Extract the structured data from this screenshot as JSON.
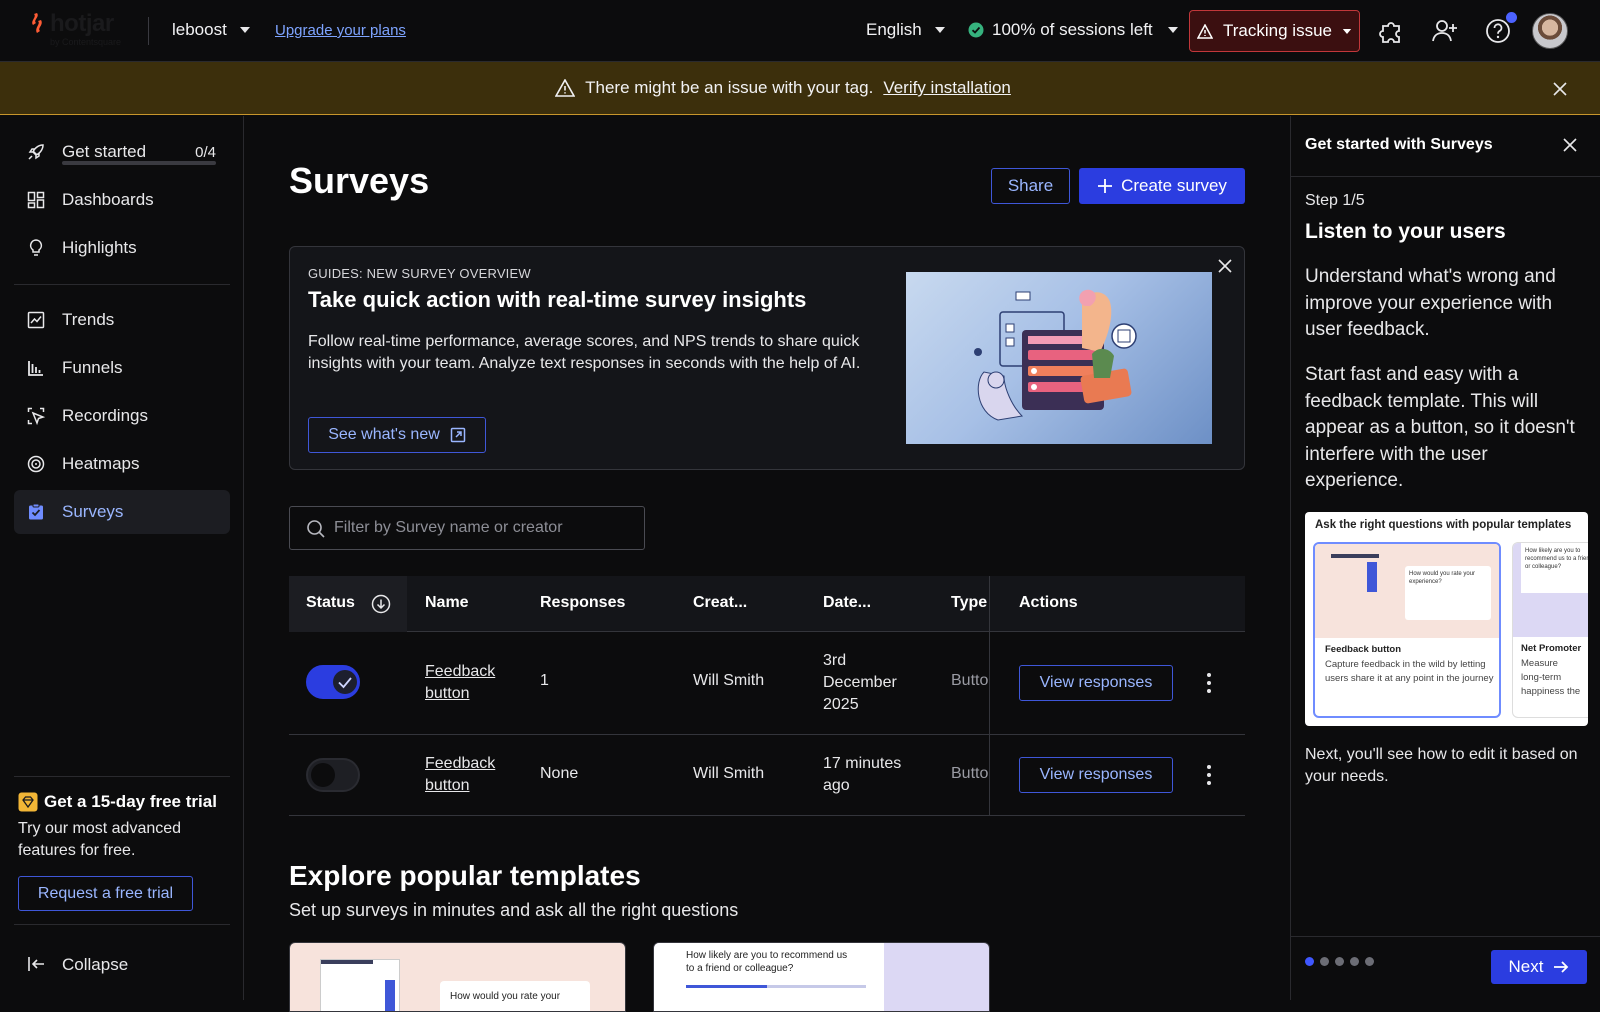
{
  "topbar": {
    "logo_text": "hotjar",
    "logo_sub": "by Contentsquare",
    "org_name": "leboost",
    "upgrade_link": "Upgrade your plans",
    "language": "English",
    "sessions": "100% of sessions left",
    "tracking": "Tracking issue"
  },
  "banner": {
    "message": "There might be an issue with your tag.",
    "link": "Verify installation"
  },
  "sidebar": {
    "get_started": {
      "label": "Get started",
      "progress": "0/4",
      "progress_fraction": 0
    },
    "items": [
      {
        "label": "Dashboards",
        "icon": "dashboard-icon"
      },
      {
        "label": "Highlights",
        "icon": "lightbulb-icon"
      },
      {
        "label": "Trends",
        "icon": "trends-icon"
      },
      {
        "label": "Funnels",
        "icon": "funnels-icon"
      },
      {
        "label": "Recordings",
        "icon": "recordings-icon"
      },
      {
        "label": "Heatmaps",
        "icon": "heatmaps-icon"
      },
      {
        "label": "Surveys",
        "icon": "surveys-icon",
        "active": true
      }
    ],
    "trial": {
      "title": "Get a 15-day free trial",
      "text": "Try our most advanced features for free.",
      "button": "Request a free trial"
    },
    "collapse": "Collapse"
  },
  "main": {
    "title": "Surveys",
    "share_button": "Share",
    "create_button": "Create survey",
    "guide": {
      "kicker": "GUIDES: NEW SURVEY OVERVIEW",
      "title": "Take quick action with real-time survey insights",
      "text": "Follow real-time performance, average scores, and NPS trends to share quick insights with your team. Analyze text responses in seconds with the help of AI.",
      "button": "See what's new"
    },
    "search": {
      "placeholder": "Filter by Survey name or creator"
    },
    "table": {
      "columns": [
        "Status",
        "Name",
        "Responses",
        "Creat...",
        "Date...",
        "Type",
        "Actions"
      ],
      "rows": [
        {
          "status_on": true,
          "name": "Feedback button",
          "responses": "1",
          "creator": "Will Smith",
          "date": "3rd December 2025",
          "type": "Button",
          "action": "View responses"
        },
        {
          "status_on": false,
          "name": "Feedback button",
          "responses": "None",
          "creator": "Will Smith",
          "date": "17 minutes ago",
          "type": "Button",
          "action": "View responses"
        }
      ]
    },
    "explore": {
      "title": "Explore popular templates",
      "subtitle": "Set up surveys in minutes and ask all the right questions",
      "card1_text": "How would you rate your",
      "card2_text": "How likely are you to recommend us to a friend or colleague?"
    }
  },
  "panel": {
    "title": "Get started with Surveys",
    "step": "Step 1/5",
    "heading": "Listen to your users",
    "para1": "Understand what's wrong and improve your experience with user feedback.",
    "para2": "Start fast and easy with a feedback template. This will appear as a button, so it doesn't interfere with the user experience.",
    "card": {
      "title": "Ask the right questions with popular templates",
      "t1_name": "Feedback button",
      "t1_desc": "Capture feedback in the wild by letting users share it at any point in the journey",
      "t1_q": "How would you rate your experience?",
      "t2_name": "Net Promoter",
      "t2_desc": "Measure long-term happiness the",
      "t2_q": "How likely are you to recommend us to a friend or colleague?"
    },
    "next_text": "Next, you'll see how to edit it based on your needs.",
    "next_button": "Next",
    "current_step": 1,
    "total_steps": 5
  },
  "colors": {
    "accent": "#2b3de0",
    "link": "#7ea4ff",
    "banner_bg": "#3c2f0c",
    "tracking_bg": "#3b0f10",
    "tracking_border": "#c2373a"
  }
}
